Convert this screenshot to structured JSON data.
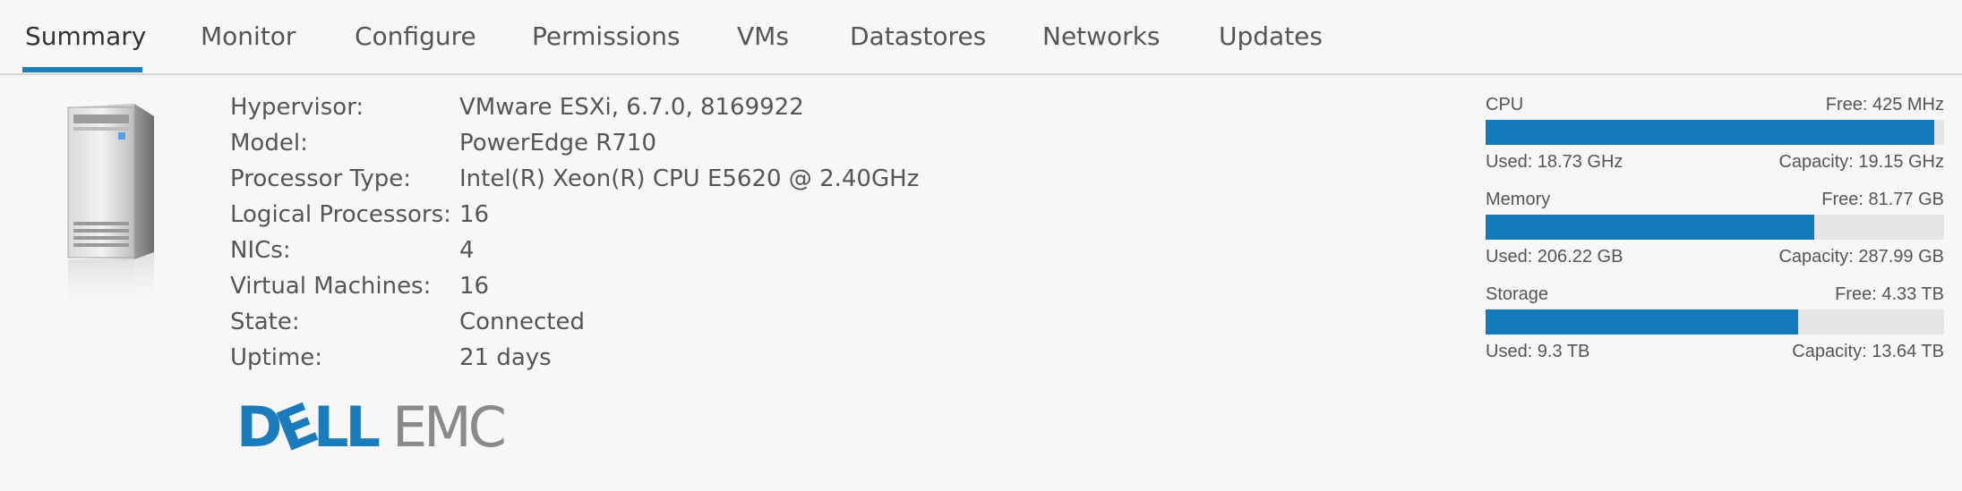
{
  "tabs": [
    {
      "label": "Summary",
      "active": true
    },
    {
      "label": "Monitor"
    },
    {
      "label": "Configure"
    },
    {
      "label": "Permissions"
    },
    {
      "label": "VMs"
    },
    {
      "label": "Datastores"
    },
    {
      "label": "Networks"
    },
    {
      "label": "Updates"
    }
  ],
  "properties": [
    {
      "label": "Hypervisor:",
      "value": "VMware ESXi, 6.7.0, 8169922"
    },
    {
      "label": "Model:",
      "value": "PowerEdge R710"
    },
    {
      "label": "Processor Type:",
      "value": "Intel(R) Xeon(R) CPU E5620 @ 2.40GHz"
    },
    {
      "label": "Logical Processors:",
      "value": "16"
    },
    {
      "label": "NICs:",
      "value": "4"
    },
    {
      "label": "Virtual Machines:",
      "value": "16"
    },
    {
      "label": "State:",
      "value": "Connected"
    },
    {
      "label": "Uptime:",
      "value": "21 days"
    }
  ],
  "logo": {
    "brand": "DELLEMC",
    "part1": "D",
    "e_letter": "E",
    "part2": "LL",
    "part3": "EMC"
  },
  "server_icon": "server-tower-icon",
  "colors": {
    "accent": "#1a7bbd",
    "bar_fill": "#1279bb",
    "bar_track": "#e6e6e6",
    "logo_blue": "#1a7bbd",
    "logo_gray": "#8a8a8a"
  },
  "resources": {
    "cpu": {
      "name": "CPU",
      "free": "Free: 425 MHz",
      "used": "Used: 18.73 GHz",
      "capacity": "Capacity: 19.15 GHz",
      "used_fraction": 0.978
    },
    "memory": {
      "name": "Memory",
      "free": "Free: 81.77 GB",
      "used": "Used: 206.22 GB",
      "capacity": "Capacity: 287.99 GB",
      "used_fraction": 0.716
    },
    "storage": {
      "name": "Storage",
      "free": "Free: 4.33 TB",
      "used": "Used: 9.3 TB",
      "capacity": "Capacity: 13.64 TB",
      "used_fraction": 0.682
    }
  }
}
